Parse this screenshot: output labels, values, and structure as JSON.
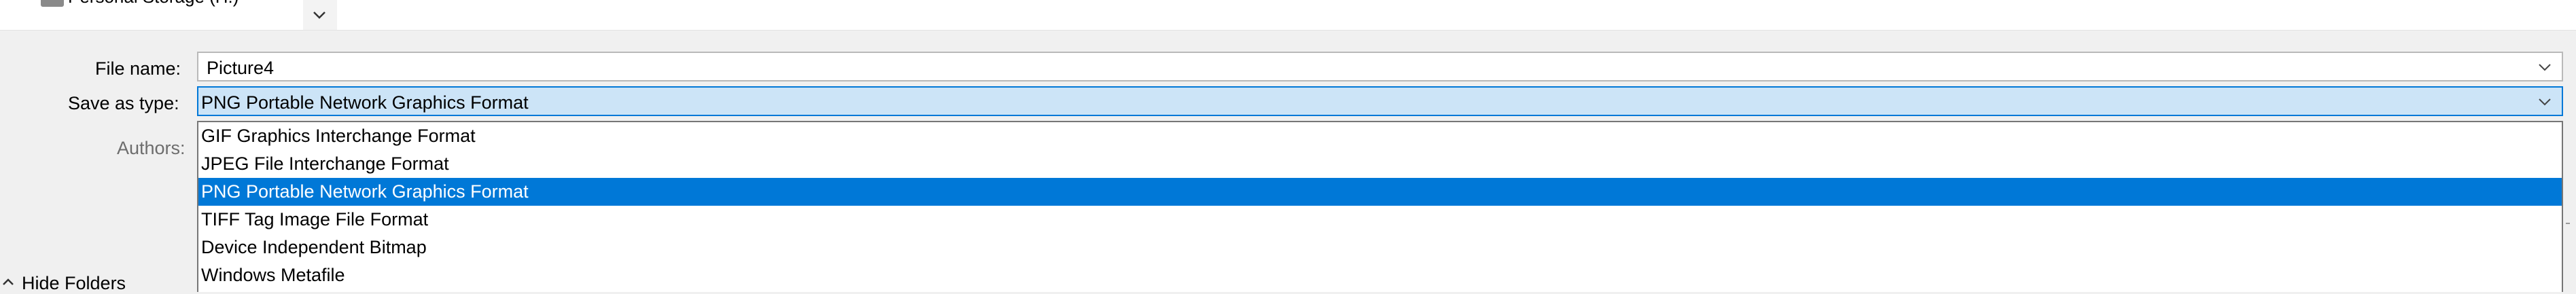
{
  "nav": {
    "storage_label": "Personal Storage (H:)"
  },
  "form": {
    "file_name_label": "File name:",
    "file_name_value": "Picture4",
    "save_type_label": "Save as type:",
    "save_type_value": "PNG Portable Network Graphics Format",
    "authors_label": "Authors:"
  },
  "dropdown": {
    "options": [
      "GIF Graphics Interchange Format",
      "JPEG File Interchange Format",
      "PNG Portable Network Graphics Format",
      "TIFF Tag Image File Format",
      "Device Independent Bitmap",
      "Windows Metafile"
    ],
    "selected_index": 2
  },
  "footer": {
    "hide_folders_label": "Hide Folders"
  },
  "colors": {
    "accent": "#0078d7",
    "selected_field_bg": "#cce4f7"
  },
  "icons": {
    "drive": "drive-icon",
    "nav_expand": "chevron-down-icon",
    "combo": "chevron-down-icon",
    "hide_folders": "chevron-up-icon"
  }
}
